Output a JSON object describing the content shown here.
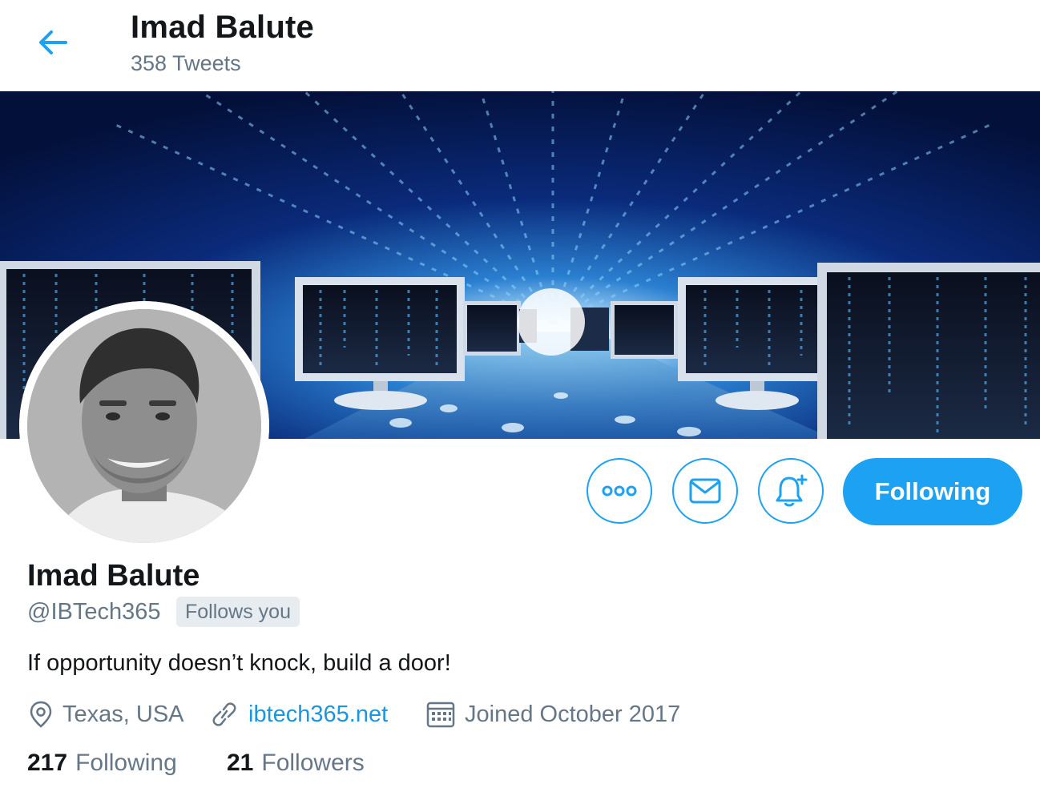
{
  "header": {
    "title": "Imad Balute",
    "tweet_count": "358 Tweets"
  },
  "icons": {
    "back": "arrow-left-icon",
    "more": "more-horizontal-icon",
    "message": "envelope-icon",
    "notify": "bell-plus-icon",
    "location": "location-pin-icon",
    "link": "link-icon",
    "calendar": "calendar-icon"
  },
  "actions": {
    "following_button": "Following"
  },
  "profile": {
    "name": "Imad Balute",
    "handle": "@IBTech365",
    "follows_you": "Follows you",
    "bio": "If opportunity doesn’t knock, build a door!",
    "location": "Texas, USA",
    "website": "ibtech365.net",
    "joined": "Joined October 2017"
  },
  "stats": {
    "following_count": "217",
    "following_label": "Following",
    "followers_count": "21",
    "followers_label": "Followers"
  },
  "colors": {
    "accent": "#1da1f2",
    "link": "#1b95e0",
    "secondary_text": "#657786",
    "primary_text": "#14171a",
    "badge_bg": "#e6ecf0"
  }
}
